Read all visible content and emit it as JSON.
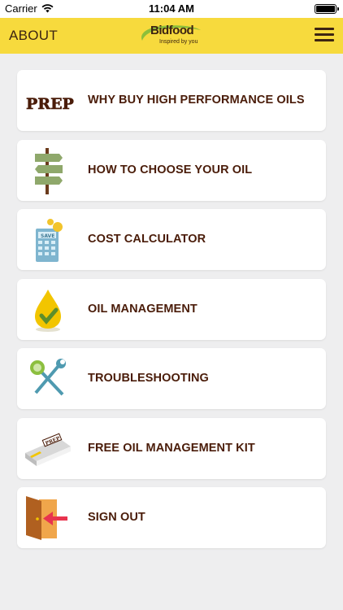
{
  "status_bar": {
    "carrier": "Carrier",
    "time": "11:04 AM"
  },
  "nav": {
    "title": "ABOUT",
    "logo": {
      "word": "Bidfood",
      "tagline": "Inspired by you"
    },
    "menu_icon": "hamburger-menu-icon"
  },
  "menu": [
    {
      "label": "WHY BUY HIGH PERFORMANCE OILS",
      "icon": "prep-logo-icon",
      "icon_text": "PREP"
    },
    {
      "label": "HOW TO CHOOSE YOUR OIL",
      "icon": "signpost-icon"
    },
    {
      "label": "COST CALCULATOR",
      "icon": "calculator-icon",
      "icon_text": "SAVE"
    },
    {
      "label": "OIL MANAGEMENT",
      "icon": "oil-drop-check-icon"
    },
    {
      "label": "TROUBLESHOOTING",
      "icon": "tools-icon"
    },
    {
      "label": "FREE OIL MANAGEMENT KIT",
      "icon": "kit-box-icon",
      "icon_text": "PREP"
    },
    {
      "label": "SIGN OUT",
      "icon": "door-exit-icon"
    }
  ],
  "colors": {
    "nav_background": "#f7da3d",
    "page_background": "#eeeeef",
    "label_text": "#4a1c09",
    "accent_green": "#8dbf3a"
  }
}
